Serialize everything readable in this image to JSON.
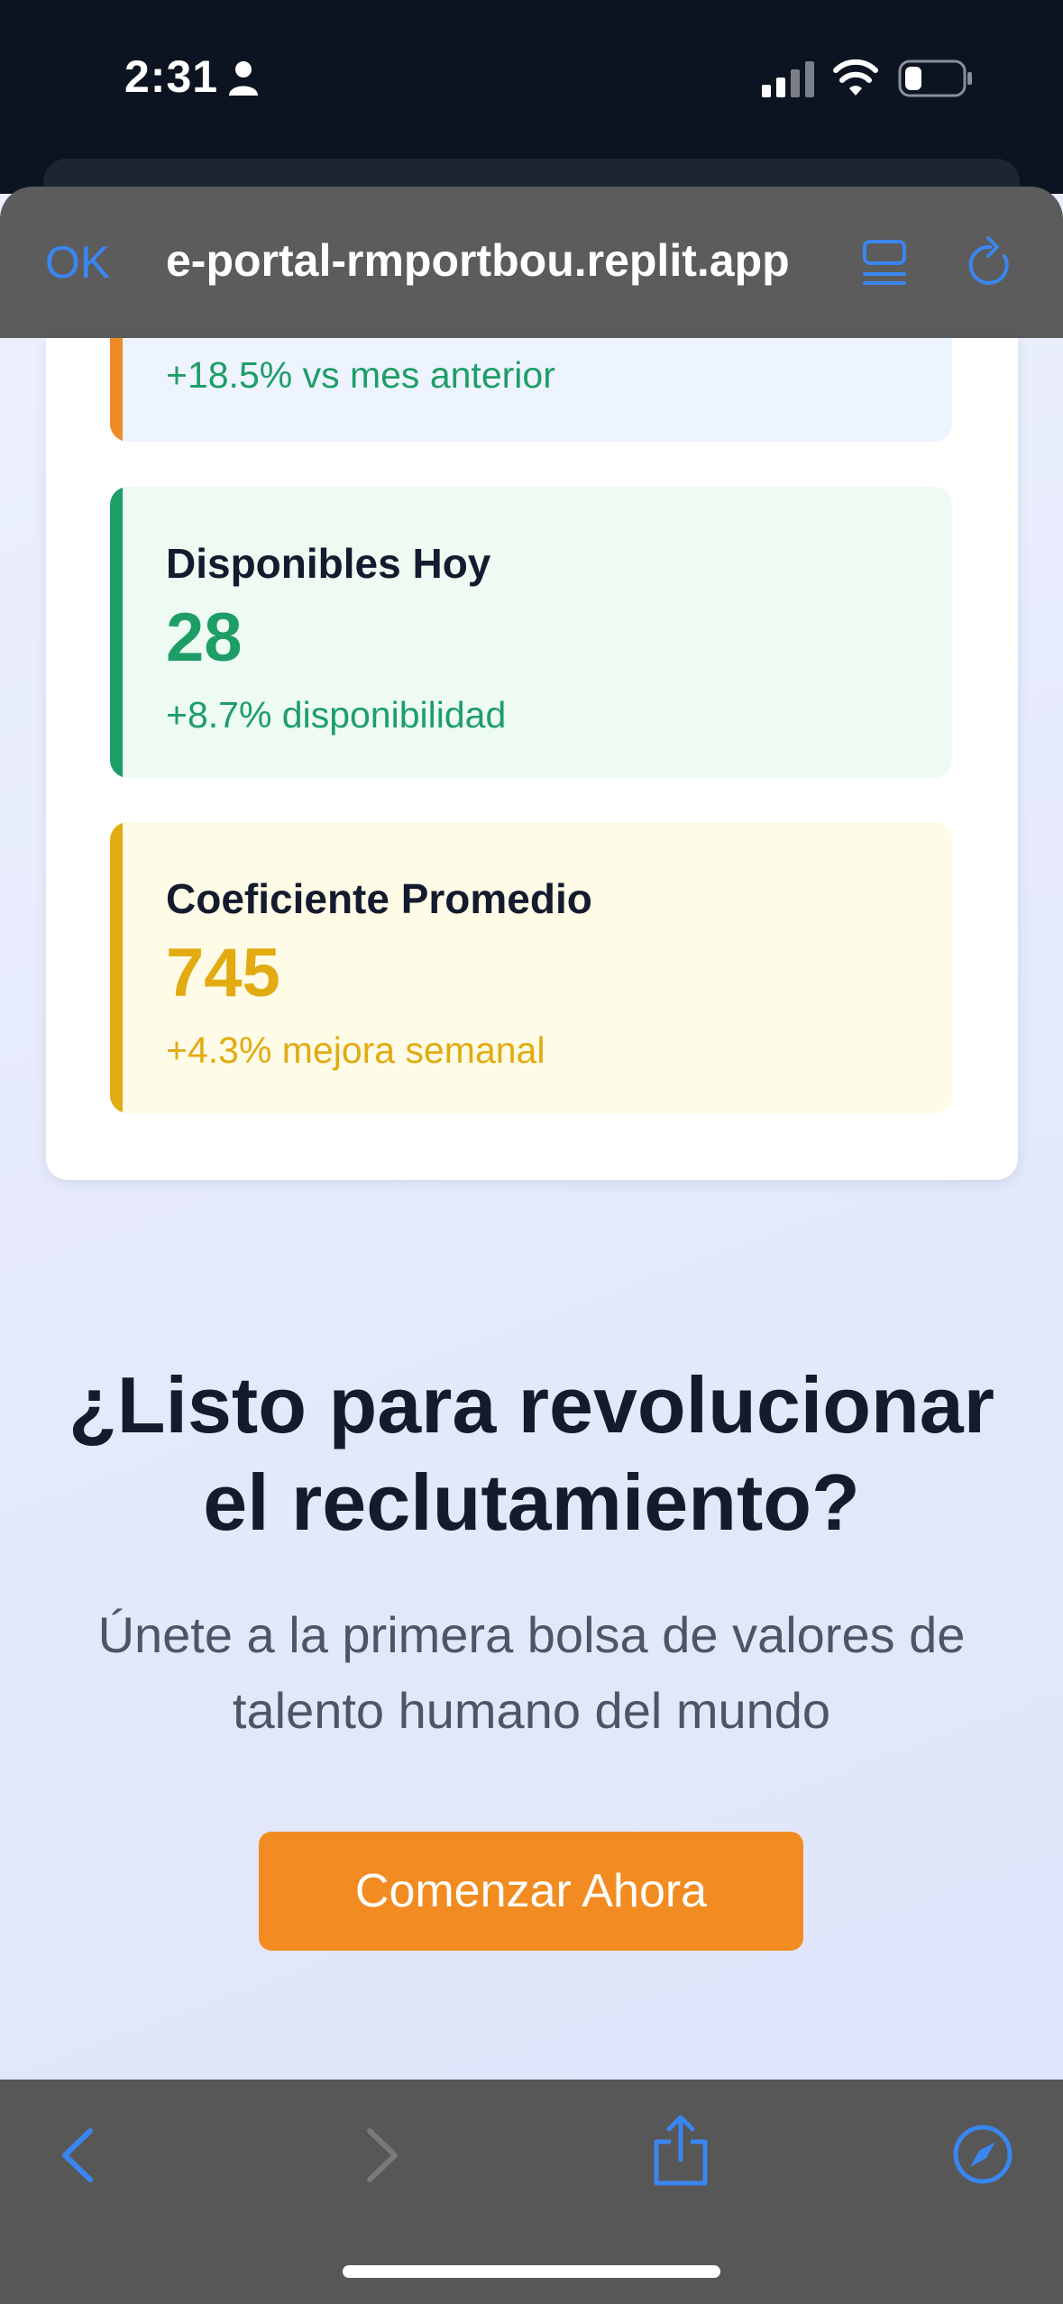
{
  "status_bar": {
    "time": "2:31"
  },
  "browser": {
    "done_label": "OK",
    "url": "e-portal-rmportbou.replit.app"
  },
  "metrics": [
    {
      "title": "",
      "value": "",
      "change": "+18.5% vs mes anterior",
      "accent_color": "#ef8a26"
    },
    {
      "title": "Disponibles Hoy",
      "value": "28",
      "change": "+8.7% disponibilidad",
      "accent_color": "#1e9e67"
    },
    {
      "title": "Coeficiente Promedio",
      "value": "745",
      "change": "+4.3% mejora semanal",
      "accent_color": "#e2ab12"
    }
  ],
  "cta": {
    "heading_line1": "¿Listo para revolucionar",
    "heading_line2": "el reclutamiento?",
    "subtitle_line1": "Únete a la primera bolsa de valores de",
    "subtitle_line2": "talento humano del mundo",
    "button_label": "Comenzar Ahora"
  },
  "colors": {
    "accent_blue": "#3a86f0",
    "cta_orange": "#f28c22"
  },
  "icons": {
    "status": [
      "person-icon",
      "signal-icon",
      "wifi-icon",
      "battery-icon"
    ],
    "address_bar": [
      "reader-icon",
      "reload-icon"
    ],
    "toolbar": [
      "back-icon",
      "forward-icon",
      "share-icon",
      "compass-icon"
    ]
  }
}
